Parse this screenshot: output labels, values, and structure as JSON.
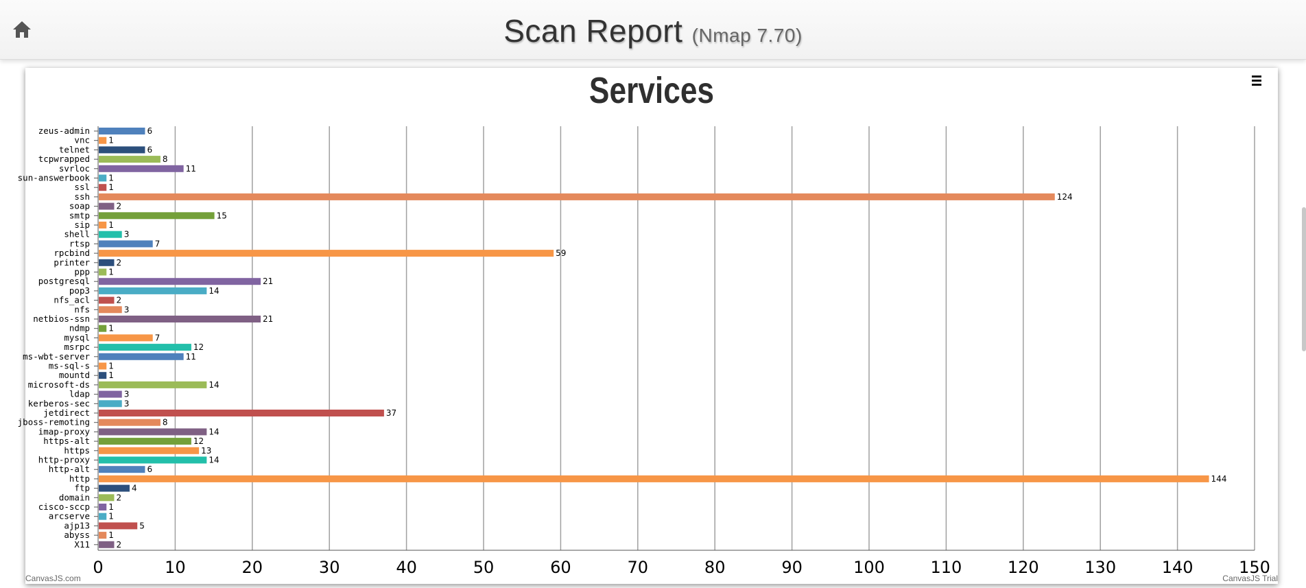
{
  "header": {
    "title": "Scan Report",
    "version": "(Nmap 7.70)"
  },
  "footer": {
    "credit_left": "CanvasJS.com",
    "credit_right": "CanvasJS Trial"
  },
  "icons": {
    "home": "home-icon",
    "menu": "hamburger-menu-icon"
  },
  "colors": {
    "palette": [
      "#4f81bc",
      "#f79647",
      "#2c4f7c",
      "#9bbb58",
      "#8064a1",
      "#4aacc5",
      "#c0504e",
      "#e4895c",
      "#7f6084",
      "#74a03a",
      "#f79647",
      "#23bfaa"
    ]
  },
  "chart_data": {
    "type": "bar",
    "orientation": "horizontal",
    "title": "Services",
    "xlim": [
      0,
      150
    ],
    "xticks": [
      0,
      10,
      20,
      30,
      40,
      50,
      60,
      70,
      80,
      90,
      100,
      110,
      120,
      130,
      140,
      150
    ],
    "grid": true,
    "data_labels": true,
    "categories": [
      "zeus-admin",
      "vnc",
      "telnet",
      "tcpwrapped",
      "svrloc",
      "sun-answerbook",
      "ssl",
      "ssh",
      "soap",
      "smtp",
      "sip",
      "shell",
      "rtsp",
      "rpcbind",
      "printer",
      "ppp",
      "postgresql",
      "pop3",
      "nfs_acl",
      "nfs",
      "netbios-ssn",
      "ndmp",
      "mysql",
      "msrpc",
      "ms-wbt-server",
      "ms-sql-s",
      "mountd",
      "microsoft-ds",
      "ldap",
      "kerberos-sec",
      "jetdirect",
      "jboss-remoting",
      "imap-proxy",
      "https-alt",
      "https",
      "http-proxy",
      "http-alt",
      "http",
      "ftp",
      "domain",
      "cisco-sccp",
      "arcserve",
      "ajp13",
      "abyss",
      "X11"
    ],
    "values": [
      6,
      1,
      6,
      8,
      11,
      1,
      1,
      124,
      2,
      15,
      1,
      3,
      7,
      59,
      2,
      1,
      21,
      14,
      2,
      3,
      21,
      1,
      7,
      12,
      11,
      1,
      1,
      14,
      3,
      3,
      37,
      8,
      14,
      12,
      13,
      14,
      6,
      144,
      4,
      2,
      1,
      1,
      5,
      1,
      2
    ]
  }
}
